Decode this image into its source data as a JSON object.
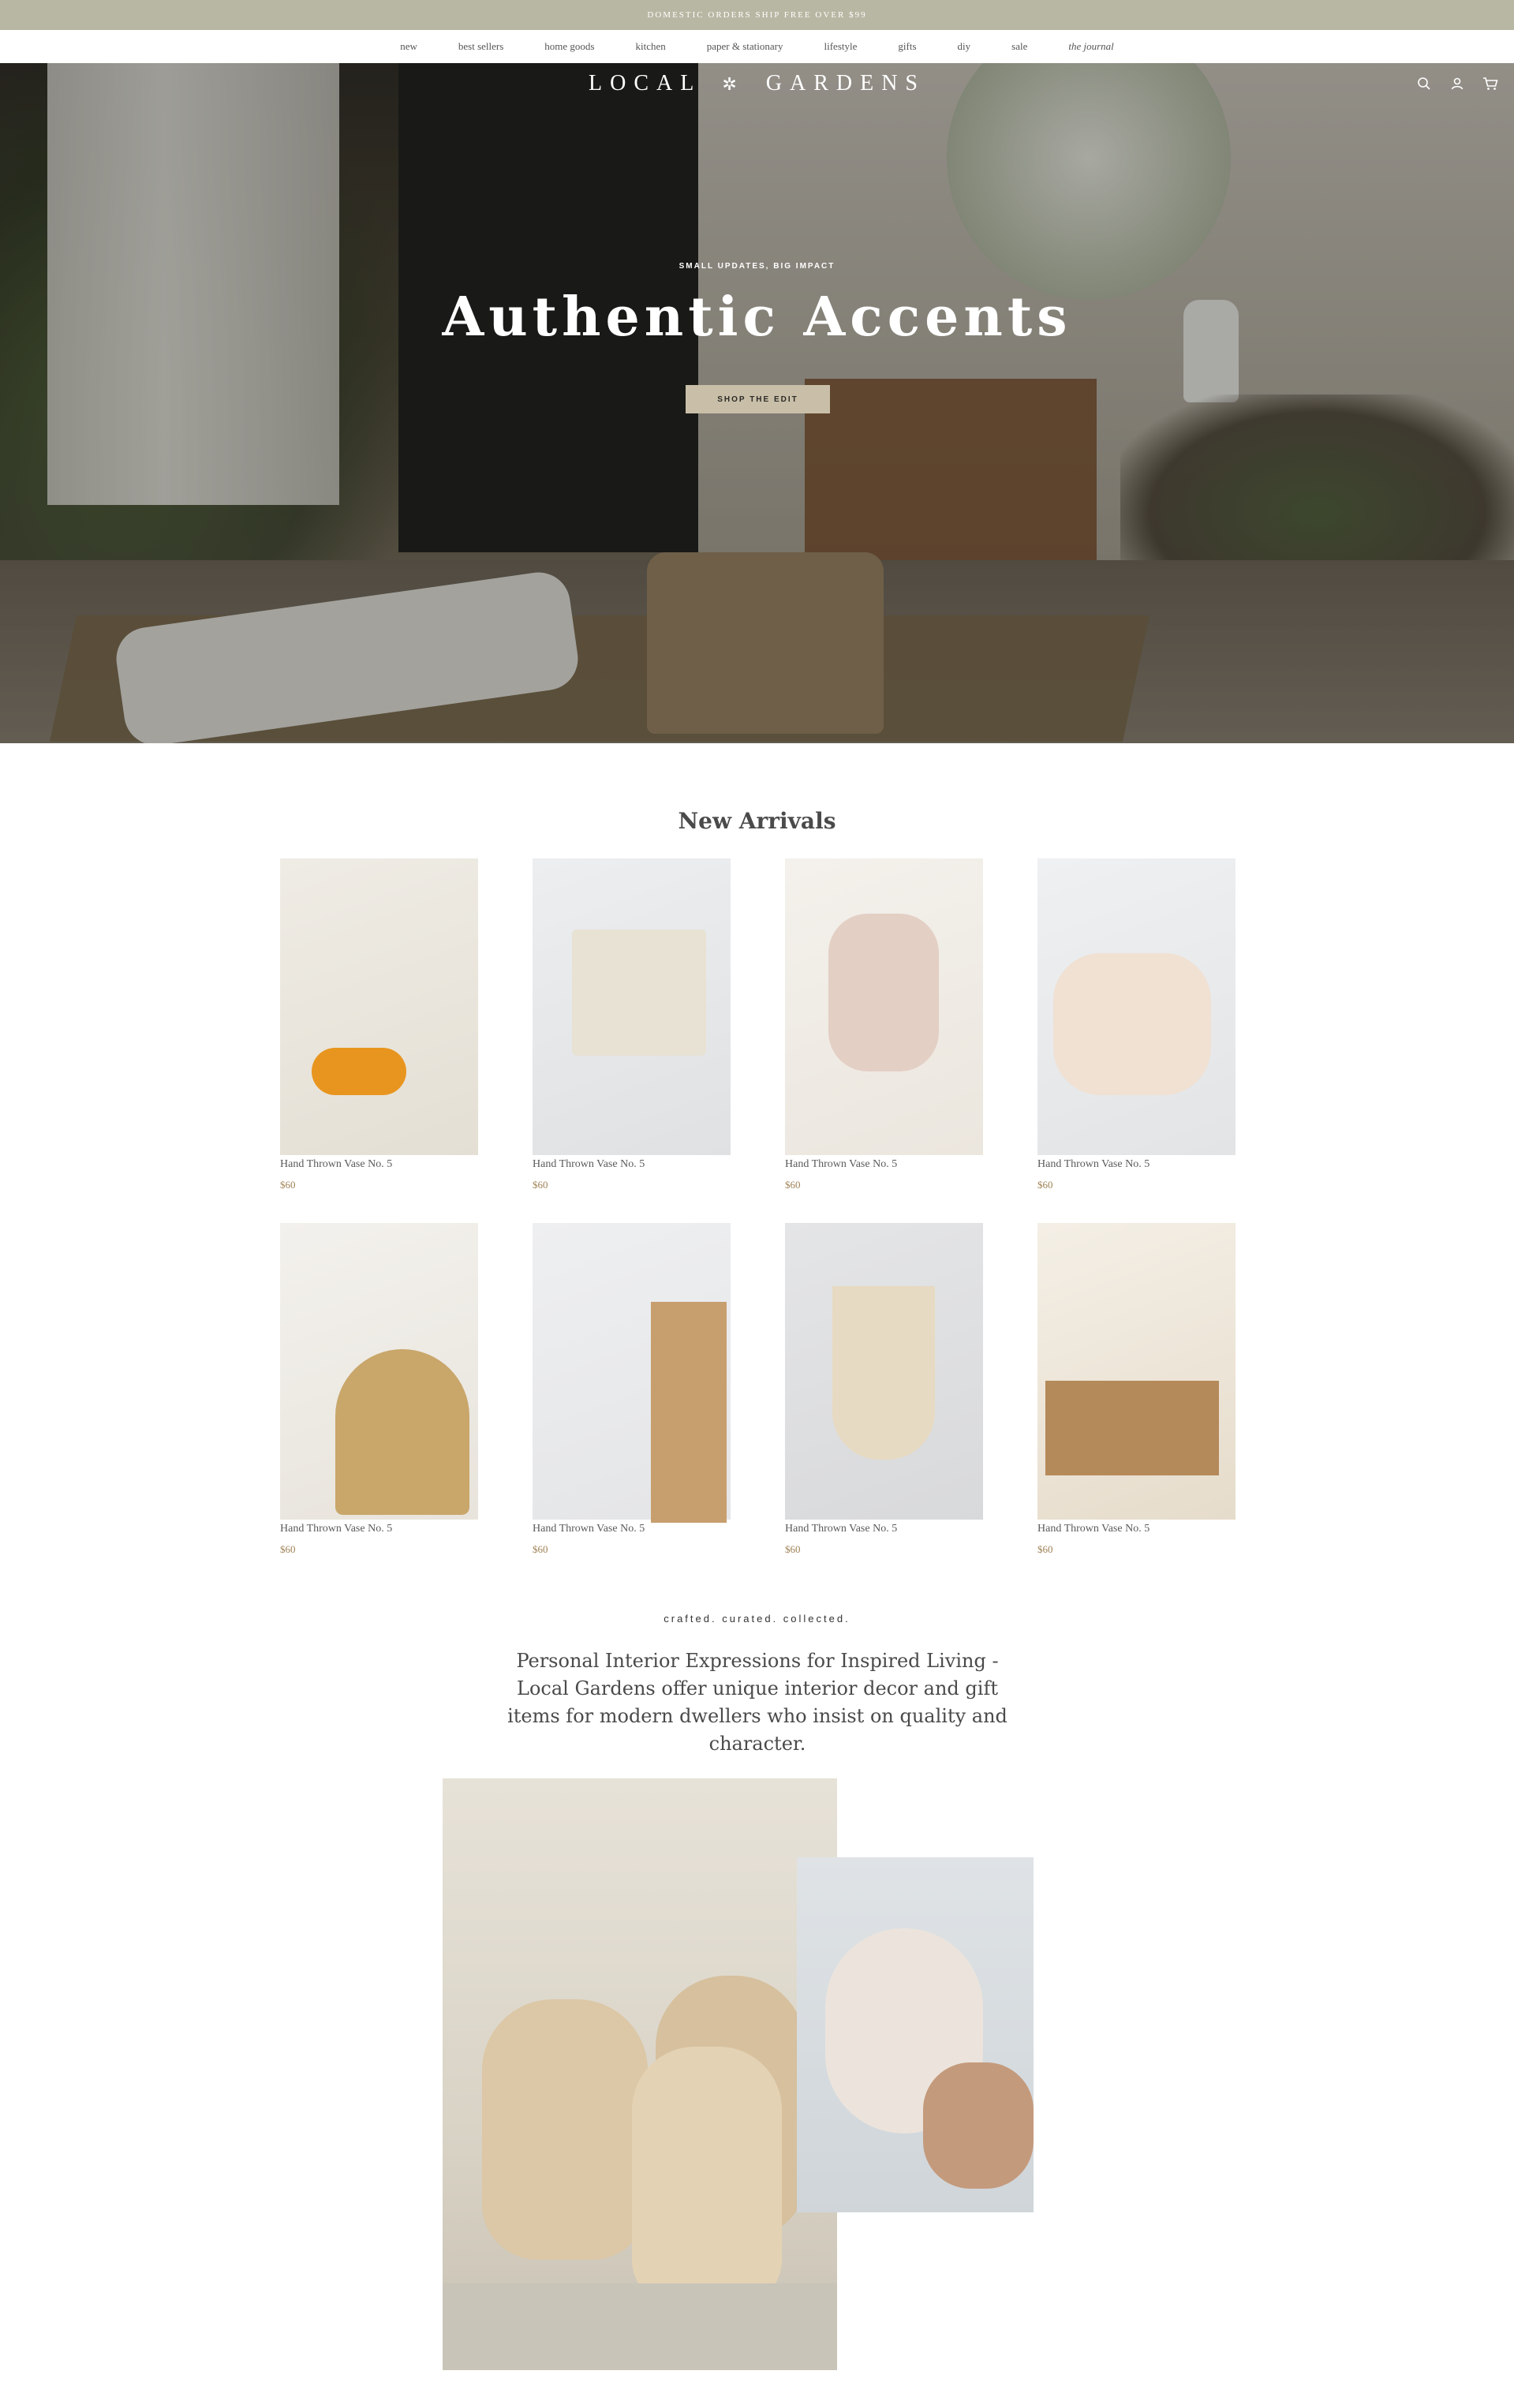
{
  "announcement": {
    "text": "DOMESTIC ORDERS SHIP FREE OVER $99"
  },
  "nav": {
    "items": [
      {
        "label": "new"
      },
      {
        "label": "best sellers"
      },
      {
        "label": "home goods"
      },
      {
        "label": "kitchen"
      },
      {
        "label": "paper & stationary"
      },
      {
        "label": "lifestyle"
      },
      {
        "label": "gifts"
      },
      {
        "label": "diy"
      },
      {
        "label": "sale"
      },
      {
        "label": "the journal"
      }
    ]
  },
  "header": {
    "brand_left": "LOCAL",
    "brand_mark": "✲",
    "brand_right": "GARDENS",
    "icons": [
      "search-icon",
      "account-icon",
      "cart-icon"
    ]
  },
  "hero": {
    "eyebrow": "SMALL UPDATES, BIG IMPACT",
    "title": "Authentic Accents",
    "button_label": "SHOP THE EDIT"
  },
  "new_arrivals": {
    "title": "New Arrivals",
    "products": [
      {
        "name": "Hand Thrown Vase No. 5",
        "price": "$60"
      },
      {
        "name": "Hand Thrown Vase No. 5",
        "price": "$60"
      },
      {
        "name": "Hand Thrown Vase No. 5",
        "price": "$60"
      },
      {
        "name": "Hand Thrown Vase No. 5",
        "price": "$60"
      },
      {
        "name": "Hand Thrown Vase No. 5",
        "price": "$60"
      },
      {
        "name": "Hand Thrown Vase No. 5",
        "price": "$60"
      },
      {
        "name": "Hand Thrown Vase No. 5",
        "price": "$60"
      },
      {
        "name": "Hand Thrown Vase No. 5",
        "price": "$60"
      }
    ]
  },
  "about": {
    "tagline": "crafted. curated. collected.",
    "text": "Personal Interior Expressions for Inspired Living - Local Gardens offer unique interior decor and gift items for modern dwellers who insist on quality and character."
  },
  "colors": {
    "announcement_bg": "#b8b7a3",
    "button_bg": "#c9bfa8",
    "price": "#a08255"
  }
}
